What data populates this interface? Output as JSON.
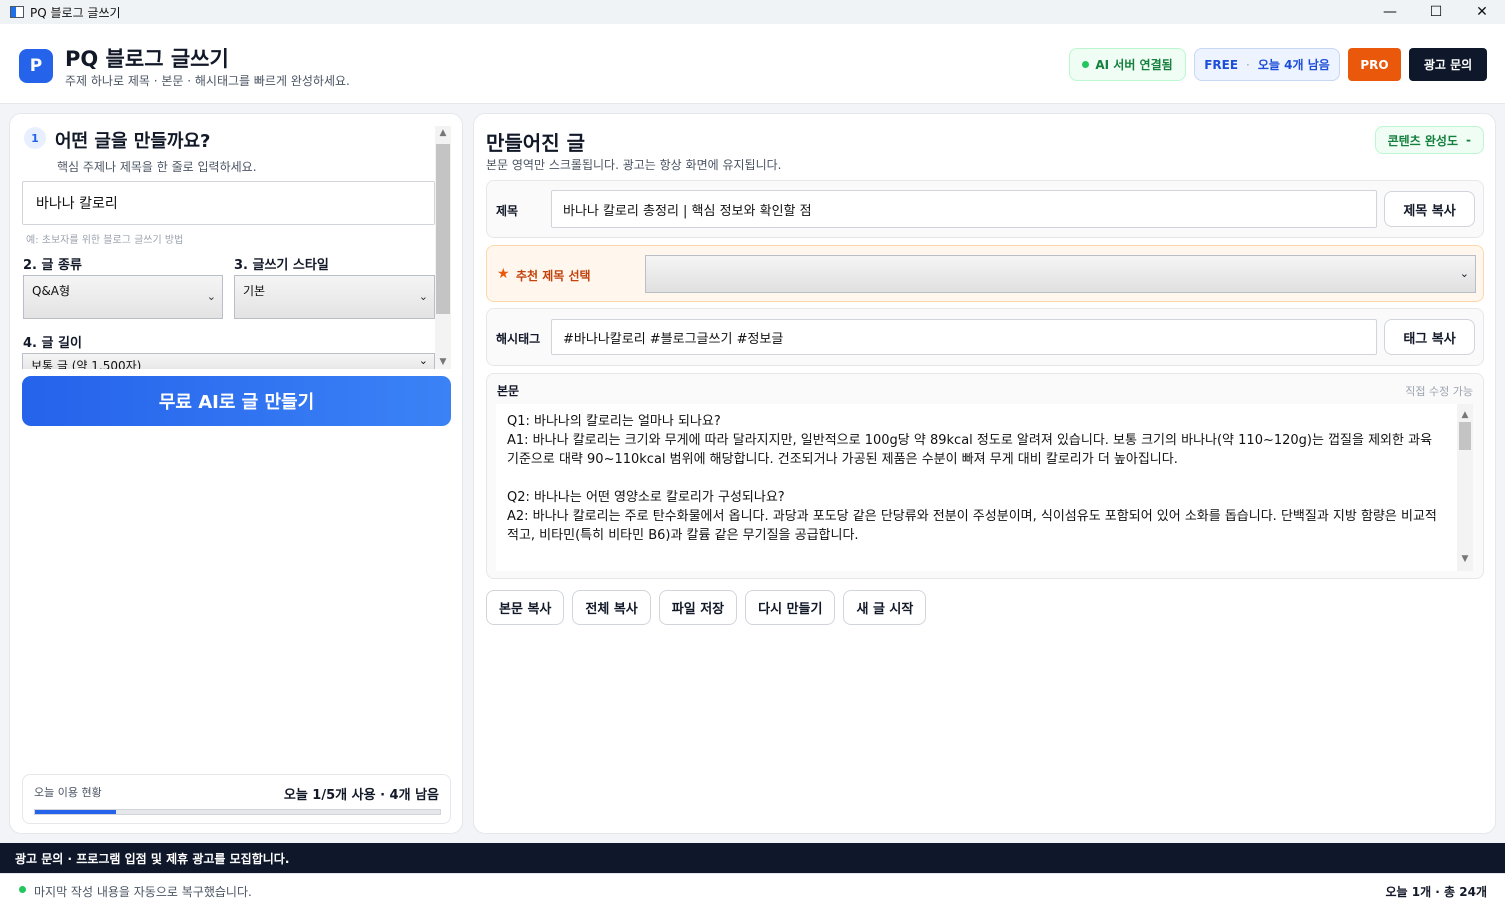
{
  "window": {
    "title": "PQ 블로그 글쓰기",
    "minimize_glyph": "—",
    "maximize_glyph": "☐",
    "close_glyph": "✕"
  },
  "header": {
    "logo_letter": "P",
    "title": "PQ 블로그 글쓰기",
    "subtitle": "주제 하나로 제목 · 본문 · 해시태그를 빠르게 완성하세요.",
    "server_status": "AI 서버 연결됨",
    "plan": "FREE",
    "plan_sep": "·",
    "remaining_today": "오늘 4개 남음",
    "pro_label": "PRO",
    "ad_inquiry_label": "광고 문의",
    "accent_color": "#2563eb",
    "pro_color": "#ea580c"
  },
  "left": {
    "step_number": "1",
    "title": "어떤 글을 만들까요?",
    "subtitle": "핵심 주제나 제목을 한 줄로 입력하세요.",
    "topic_value": "바나나 칼로리",
    "topic_hint": "예: 초보자를 위한 블로그 글쓰기 방법",
    "type_label": "2. 글 종류",
    "type_value": "Q&A형",
    "style_label": "3. 글쓰기 스타일",
    "style_value": "기본",
    "length_label": "4. 글 길이",
    "length_value": "보통 글 (약 1,500자)",
    "generate_label": "무료 AI로 글 만들기",
    "usage_label": "오늘 이용 현황",
    "usage_count": "오늘 1/5개 사용 · 4개 남음",
    "usage_fraction": 0.2
  },
  "right": {
    "title": "만들어진 글",
    "subtitle": "본문 영역만 스크롤됩니다. 광고는 항상 화면에 유지됩니다.",
    "completion_label": "콘텐츠 완성도",
    "completion_value": "-",
    "title_label": "제목",
    "title_value": "바나나 칼로리 총정리 | 핵심 정보와 확인할 점",
    "copy_title_label": "제목 복사",
    "reco_label": "추천 제목 선택",
    "tags_label": "해시태그",
    "tags_value": "#바나나칼로리 #블로그글쓰기 #정보글",
    "copy_tags_label": "태그 복사",
    "body_label": "본문",
    "body_hint": "직접 수정 가능",
    "body_lines": [
      "Q1: 바나나의 칼로리는 얼마나 되나요?",
      "A1: 바나나 칼로리는 크기와 무게에 따라 달라지지만, 일반적으로 100g당 약 89kcal 정도로 알려져 있습니다. 보통 크기의 바나나(약 110~120g)는 껍질을 제외한 과육 기준으로 대략 90~110kcal 범위에 해당합니다. 건조되거나 가공된 제품은 수분이 빠져 무게 대비 칼로리가 더 높아집니다.",
      "",
      "Q2: 바나나는 어떤 영양소로 칼로리가 구성되나요?",
      "A2: 바나나 칼로리는 주로 탄수화물에서 옵니다. 과당과 포도당 같은 단당류와 전분이 주성분이며, 식이섬유도 포함되어 있어 소화를 돕습니다. 단백질과 지방 함량은 비교적 적고, 비타민(특히 비타민 B6)과 칼륨 같은 무기질을 공급합니다."
    ],
    "actions": [
      "본문 복사",
      "전체 복사",
      "파일 저장",
      "다시 만들기",
      "새 글 시작"
    ]
  },
  "footer": {
    "ad_text": "광고 문의 · 프로그램 입점 및 제휴 광고를 모집합니다.",
    "status_text": "마지막 작성 내용을 자동으로 복구했습니다.",
    "counts_text": "오늘 1개 · 총 24개"
  }
}
